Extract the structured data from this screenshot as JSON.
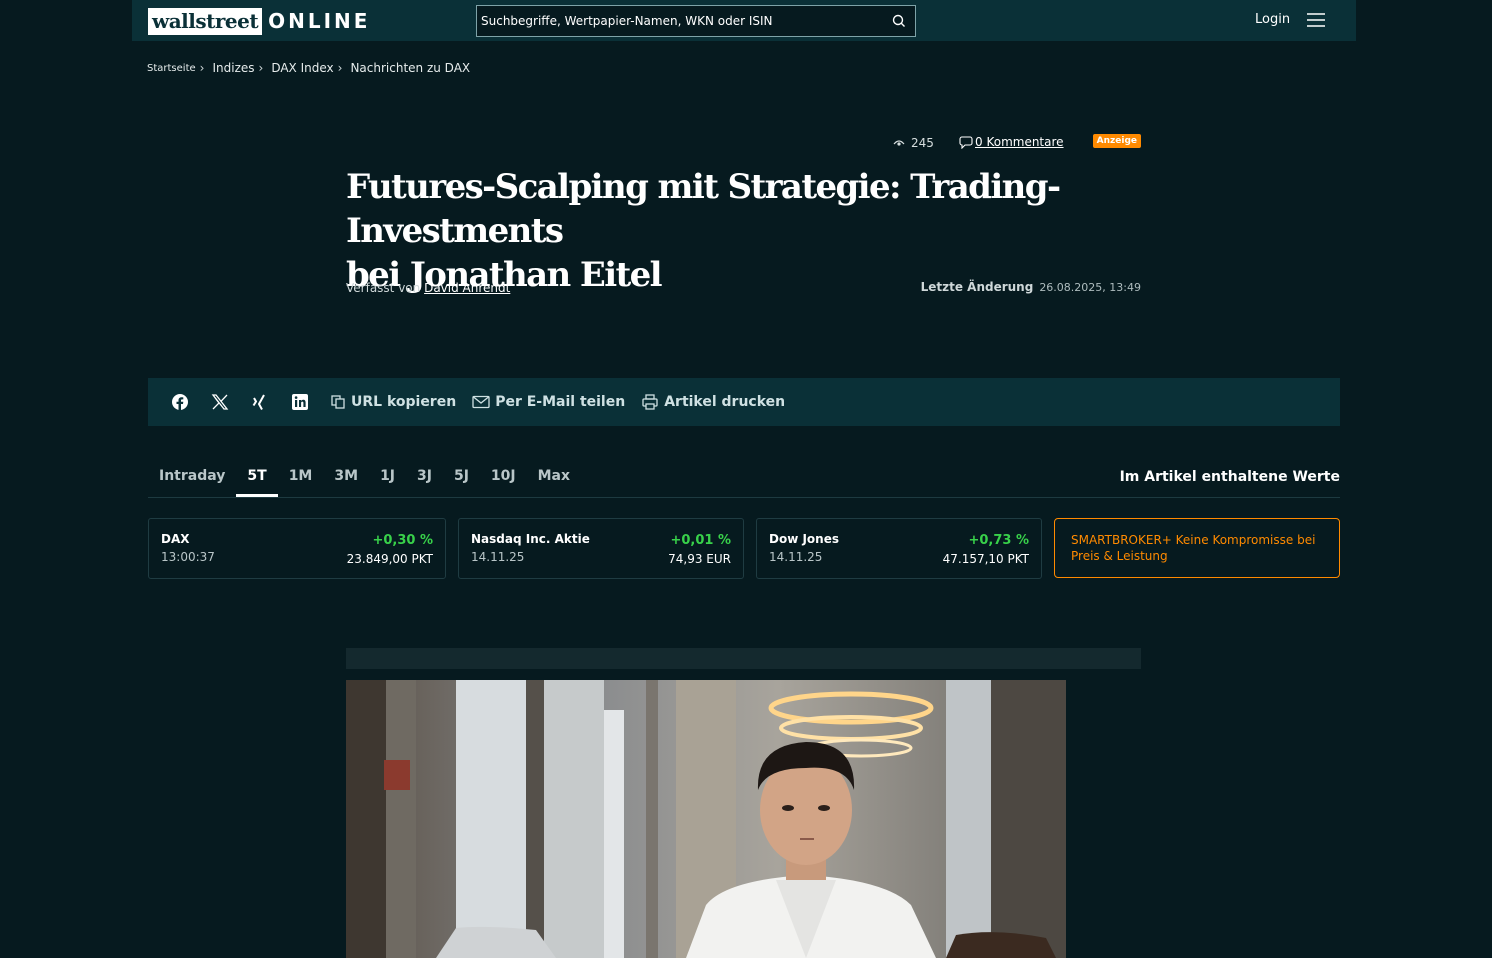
{
  "header": {
    "logo_left": "wallstreet",
    "logo_right": "ONLINE",
    "search_placeholder": "Suchbegriffe, Wertpapier-Namen, WKN oder ISIN",
    "login": "Login"
  },
  "breadcrumb": [
    "Startseite",
    "Indizes",
    "DAX Index",
    "Nachrichten zu DAX"
  ],
  "article": {
    "views": "245",
    "comments": "0 Kommentare",
    "ad_badge": "Anzeige",
    "title_line1": "Futures-Scalping mit Strategie: Trading-Investments",
    "title_line2": "bei Jonathan Eitel",
    "author_prefix": "Verfasst von",
    "author": "David Ahrendt",
    "modified_label": "Letzte Änderung",
    "modified_value": "26.08.2025, 13:49"
  },
  "share": {
    "icons": [
      "facebook-icon",
      "x-icon",
      "xing-icon",
      "linkedin-icon"
    ],
    "copy_url": "URL kopieren",
    "email": "Per E-Mail teilen",
    "print": "Artikel drucken"
  },
  "tabs": [
    {
      "label": "Intraday",
      "active": false
    },
    {
      "label": "5T",
      "active": true
    },
    {
      "label": "1M",
      "active": false
    },
    {
      "label": "3M",
      "active": false
    },
    {
      "label": "1J",
      "active": false
    },
    {
      "label": "3J",
      "active": false
    },
    {
      "label": "5J",
      "active": false
    },
    {
      "label": "10J",
      "active": false
    },
    {
      "label": "Max",
      "active": false
    }
  ],
  "values_title": "Im Artikel enthaltene Werte",
  "cards": [
    {
      "name": "DAX",
      "time": "13:00:37",
      "change": "+0,30 %",
      "price": "23.849,00 PKT"
    },
    {
      "name": "Nasdaq Inc. Aktie",
      "time": "14.11.25",
      "change": "+0,01 %",
      "price": "74,93 EUR"
    },
    {
      "name": "Dow Jones",
      "time": "14.11.25",
      "change": "+0,73 %",
      "price": "47.157,10 PKT"
    }
  ],
  "promo": "SMARTBROKER+ Keine Kompromisse bei Preis & Leistung",
  "colors": {
    "background": "#061a1f",
    "bar": "#0a3037",
    "positive": "#38d14a",
    "accent": "#ff8a00"
  }
}
